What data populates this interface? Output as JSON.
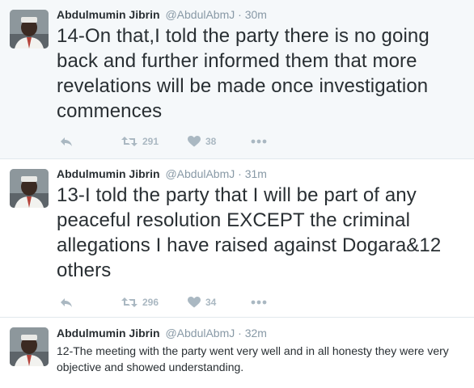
{
  "tweets": [
    {
      "fullname": "Abdulmumin Jibrin",
      "username": "@AbdulAbmJ",
      "separator": "·",
      "time": "30m",
      "text": "14-On that,I told the party there is no going back and further informed them that more revelations will be made once investigation commences",
      "retweets": "291",
      "likes": "38"
    },
    {
      "fullname": "Abdulmumin Jibrin",
      "username": "@AbdulAbmJ",
      "separator": "·",
      "time": "31m",
      "text": "13-I told the party that I will be part of any peaceful resolution EXCEPT the criminal allegations I have raised against Dogara&12 others",
      "retweets": "296",
      "likes": "34"
    },
    {
      "fullname": "Abdulmumin Jibrin",
      "username": "@AbdulAbmJ",
      "separator": "·",
      "time": "32m",
      "text": "12-The meeting with the party went very well and in all honesty they were very objective and showed understanding."
    }
  ],
  "icons": {
    "reply": "reply-icon",
    "retweet": "retweet-icon",
    "like": "heart-icon",
    "more": "more-icon"
  },
  "colors": {
    "highlight_bg": "#f5f8fa",
    "action_gray": "#aab8c2",
    "meta_gray": "#8899a6",
    "divider": "#e1e8ed"
  }
}
